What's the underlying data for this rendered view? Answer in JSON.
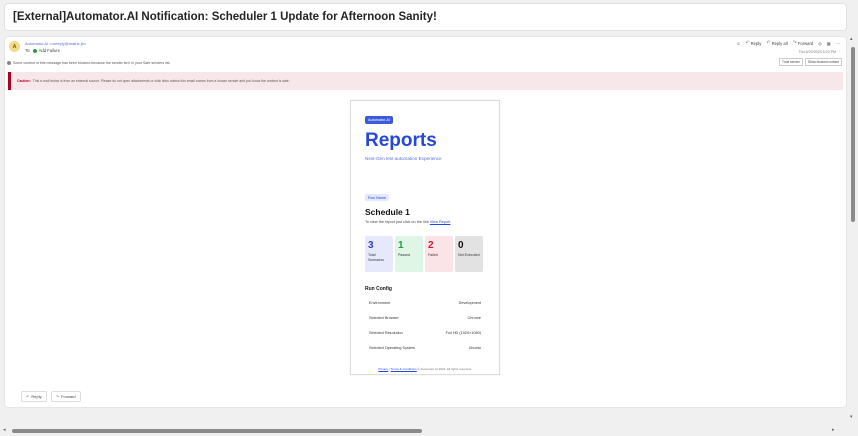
{
  "subject": "[External]Automator.AI Notification: Scheduler 1 Update for Afternoon Sanity!",
  "header": {
    "avatar": "A",
    "from": "Automator.AI <noreply@matrix.jb>",
    "to_label": "To:",
    "to_value": "Add Failure",
    "actions": [
      "Reply",
      "Reply all",
      "Forward"
    ],
    "date": "Thu 6/22/2023 5:22 PM"
  },
  "blocked": {
    "text": "Some content in this message has been blocked because the sender isn't in your Safe senders list.",
    "trust_label": "Trust sender",
    "show_label": "Show blocked content"
  },
  "caution": {
    "label": "Caution:",
    "text": "This e-mail below is from an external source. Please do not open attachments or click links unless this email comes from a known sender and you know the content is safe."
  },
  "email": {
    "badge": "Automator.AI",
    "title": "Reports",
    "tagline": "Next-Gen test automation Experience",
    "run_name_label": "Run Name",
    "schedule": "Schedule 1",
    "view_text": "To view the report just click on the link",
    "view_link": "View Report",
    "stats": [
      {
        "value": "3",
        "label": "Total Scenarios"
      },
      {
        "value": "1",
        "label": "Passed"
      },
      {
        "value": "2",
        "label": "Failed"
      },
      {
        "value": "0",
        "label": "Not Executed"
      }
    ],
    "config_title": "Run Config",
    "config": [
      {
        "key": "Environment",
        "value": "Development"
      },
      {
        "key": "Selected Browser",
        "value": "Chrome"
      },
      {
        "key": "Selected Resolution",
        "value": "Full HD (1920×1080)"
      },
      {
        "key": "Selected Operating System",
        "value": "Ubuntu"
      }
    ],
    "footer_privacy": "Privacy",
    "footer_terms": "Terms & Conditions",
    "footer_rest": "© Automator.AI 2024. All rights reserved."
  },
  "bottom": {
    "reply": "Reply",
    "forward": "Forward"
  }
}
